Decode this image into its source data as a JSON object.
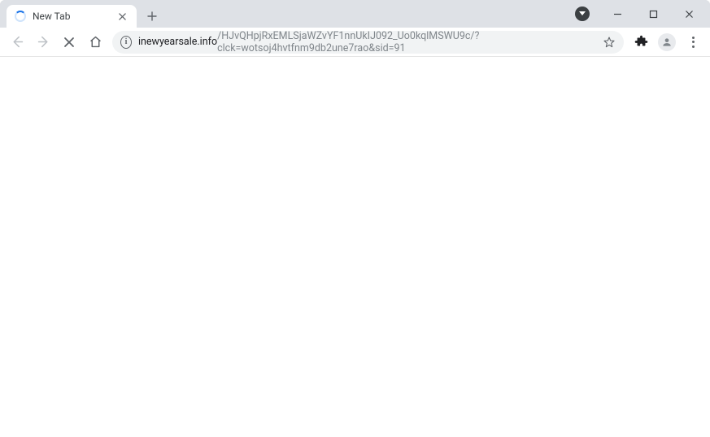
{
  "tab": {
    "title": "New Tab"
  },
  "url": {
    "host": "inewyearsale.info",
    "path": "/HJvQHpjRxEMLSjaWZvYF1nnUkIJ092_Uo0kqlMSWU9c/?clck=wotsoj4hvtfnm9db2une7rao&sid=91"
  }
}
